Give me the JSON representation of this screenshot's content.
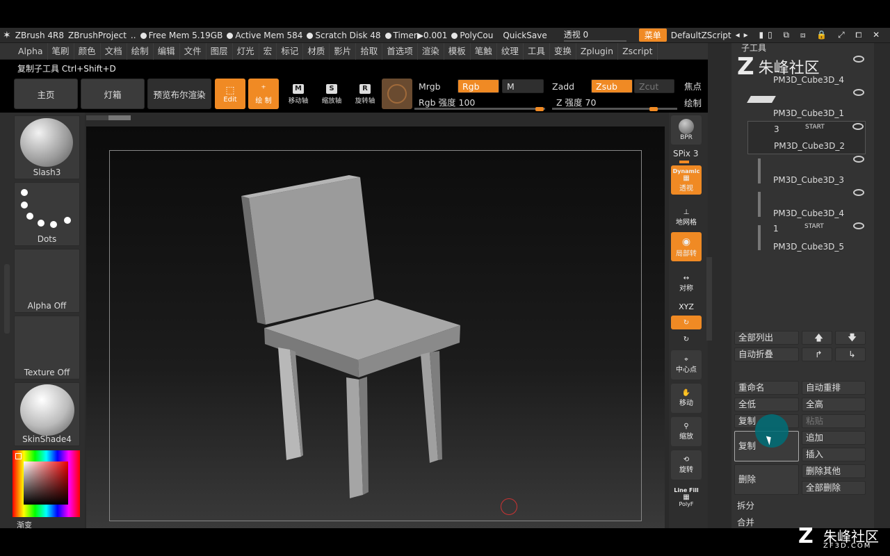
{
  "topbar": {
    "app": "ZBrush 4R8",
    "project": "ZBrushProject",
    "free_mem": "Free Mem 5.19GB",
    "active_mem": "Active Mem 584",
    "scratch": "Scratch Disk 48",
    "timer": "Timer▶0.001",
    "polycount": "PolyCou",
    "quicksave": "QuickSave",
    "perspective": "透视  0",
    "menu": "菜单",
    "script": "DefaultZScript"
  },
  "menu": [
    "Alpha",
    "笔刷",
    "颜色",
    "文档",
    "绘制",
    "编辑",
    "文件",
    "图层",
    "灯光",
    "宏",
    "标记",
    "材质",
    "影片",
    "拾取",
    "首选项",
    "渲染",
    "模板",
    "笔触",
    "纹理",
    "工具",
    "变换",
    "Zplugin",
    "Zscript"
  ],
  "tooltip": "复制子工具 Ctrl+Shift+D",
  "toolbar": {
    "home": "主页",
    "lightbox": "灯箱",
    "bpr_preview": "预览布尔渲染",
    "edit": "Edit",
    "draw": "绘 制",
    "move": "移动轴",
    "scale": "缩放轴",
    "rotate": "旋转轴",
    "mrgb": "Mrgb",
    "rgb": "Rgb",
    "m": "M",
    "zadd": "Zadd",
    "zsub": "Zsub",
    "zcut": "Zcut",
    "rgb_intensity": "Rgb 强度 100",
    "z_intensity": "Z 强度 70",
    "focal": "焦点",
    "draw_size": "绘制"
  },
  "left_shelf": {
    "brush": "Slash3",
    "stroke": "Dots",
    "alpha": "Alpha Off",
    "texture": "Texture Off",
    "material": "SkinShade4",
    "gradient": "渐变"
  },
  "right_shelf": {
    "bpr": "BPR",
    "spix": "SPix 3",
    "dynamic": "Dynamic",
    "persp": "透视",
    "floor": "地网格",
    "local": "局部转",
    "sym": "对称",
    "xyz": "XYZ",
    "center": "中心点",
    "move": "移动",
    "scale": "缩放",
    "rotate": "旋转",
    "linefill": "Line Fill",
    "polyf": "PolyF"
  },
  "subtool": {
    "header": "子工具",
    "items": [
      {
        "name": "PM3D_Cube3D_4",
        "num": ""
      },
      {
        "name": "PM3D_Cube3D_1",
        "num": ""
      },
      {
        "name": "PM3D_Cube3D_2",
        "num": "3",
        "flag": "START"
      },
      {
        "name": "PM3D_Cube3D_3",
        "num": ""
      },
      {
        "name": "PM3D_Cube3D_4",
        "num": ""
      },
      {
        "name": "PM3D_Cube3D_5",
        "num": "1",
        "flag": "START"
      }
    ],
    "list_all": "全部列出",
    "auto_collapse": "自动折叠",
    "rename": "重命名",
    "auto_reorder": "自动重排",
    "all_low": "全低",
    "all_high": "全高",
    "copy": "复制",
    "paste": "粘贴",
    "duplicate": "复制",
    "append": "追加",
    "insert": "插入",
    "delete": "删除",
    "delete_other": "删除其他",
    "delete_all": "全部删除",
    "split": "拆分",
    "merge": "合并"
  },
  "watermark": {
    "brand": "朱峰社区",
    "site": "ZF3D.COM"
  },
  "colors": {
    "accent": "#f08a24",
    "panel": "#333333"
  }
}
